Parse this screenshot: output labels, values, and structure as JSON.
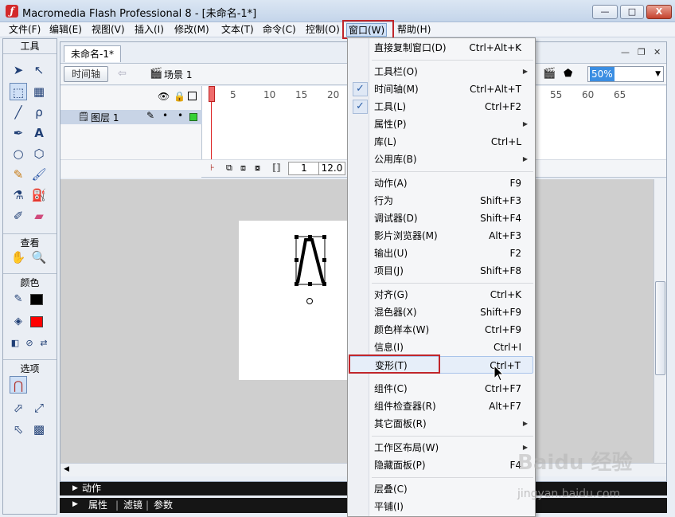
{
  "window": {
    "title": "Macromedia Flash Professional 8 - [未命名-1*]",
    "minimize": "—",
    "maximize": "□",
    "close": "X"
  },
  "menubar": [
    "文件(F)",
    "编辑(E)",
    "视图(V)",
    "插入(I)",
    "修改(M)",
    "文本(T)",
    "命令(C)",
    "控制(O)",
    "窗口(W)",
    "帮助(H)"
  ],
  "tools_panel": {
    "header": "工具",
    "view_label": "查看",
    "color_label": "颜色",
    "options_label": "选项",
    "stroke_color": "#000000",
    "fill_color": "#ff0000"
  },
  "document": {
    "tab": "未命名-1*",
    "timeline_button": "时间轴",
    "scene_label": "场景 1",
    "zoom": "50%",
    "layer_name": "图层 1",
    "frame_numbers": [
      "1",
      "5",
      "10",
      "15",
      "20",
      "55",
      "60",
      "65"
    ],
    "current_frame": "1",
    "frame_rate": "12.0"
  },
  "panels": {
    "actions": "动作",
    "properties": "属性",
    "filters": "滤镜",
    "parameters": "参数"
  },
  "window_menu": {
    "items": [
      {
        "label": "直接复制窗口(D)",
        "shortcut": "Ctrl+Alt+K"
      },
      {
        "label": "工具栏(O)",
        "submenu": true
      },
      {
        "label": "时间轴(M)",
        "shortcut": "Ctrl+Alt+T",
        "checked": true
      },
      {
        "label": "工具(L)",
        "shortcut": "Ctrl+F2",
        "checked": true
      },
      {
        "label": "属性(P)",
        "submenu": true
      },
      {
        "label": "库(L)",
        "shortcut": "Ctrl+L"
      },
      {
        "label": "公用库(B)",
        "submenu": true
      },
      {
        "label": "动作(A)",
        "shortcut": "F9"
      },
      {
        "label": "行为",
        "shortcut": "Shift+F3"
      },
      {
        "label": "调试器(D)",
        "shortcut": "Shift+F4"
      },
      {
        "label": "影片浏览器(M)",
        "shortcut": "Alt+F3"
      },
      {
        "label": "输出(U)",
        "shortcut": "F2"
      },
      {
        "label": "项目(J)",
        "shortcut": "Shift+F8"
      },
      {
        "label": "对齐(G)",
        "shortcut": "Ctrl+K"
      },
      {
        "label": "混色器(X)",
        "shortcut": "Shift+F9"
      },
      {
        "label": "颜色样本(W)",
        "shortcut": "Ctrl+F9"
      },
      {
        "label": "信息(I)",
        "shortcut": "Ctrl+I"
      },
      {
        "label": "变形(T)",
        "shortcut": "Ctrl+T",
        "highlighted": true
      },
      {
        "label": "组件(C)",
        "shortcut": "Ctrl+F7"
      },
      {
        "label": "组件检查器(R)",
        "shortcut": "Alt+F7"
      },
      {
        "label": "其它面板(R)",
        "submenu": true
      },
      {
        "label": "工作区布局(W)",
        "submenu": true
      },
      {
        "label": "隐藏面板(P)",
        "shortcut": "F4"
      },
      {
        "label": "层叠(C)"
      },
      {
        "label": "平铺(I)"
      }
    ]
  },
  "watermark": {
    "brand": "Baidu 经验",
    "url": "jingyan.baidu.com"
  },
  "accent_colors": {
    "highlight_box": "#c0262b",
    "menu_hover": "#e6eef9"
  }
}
